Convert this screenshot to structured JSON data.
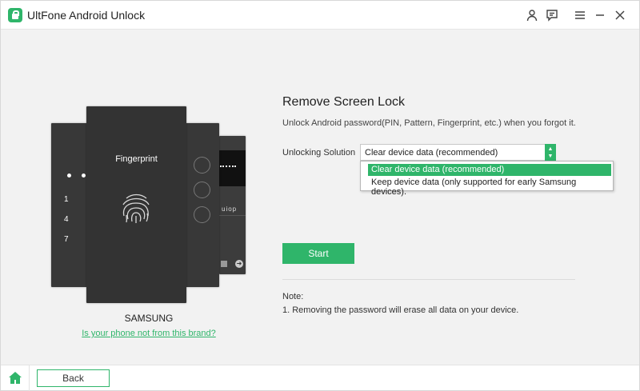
{
  "titlebar": {
    "app_title": "UltFone Android Unlock",
    "icons": [
      "user-icon",
      "feedback-icon",
      "menu-icon",
      "minimize-icon",
      "close-icon"
    ]
  },
  "illustration": {
    "front_label": "Fingerprint",
    "left_digits": [
      "1",
      "4",
      "7"
    ],
    "back_keys": "uiop"
  },
  "brand": {
    "name": "SAMSUNG",
    "link": "Is your phone not from this brand?"
  },
  "panel": {
    "title": "Remove Screen Lock",
    "description": "Unlock Android password(PIN, Pattern, Fingerprint, etc.) when you forgot it.",
    "solution_label": "Unlocking Solution",
    "selected": "Clear device data (recommended)",
    "options": [
      "Clear device data (recommended)",
      "Keep device data (only supported for early Samsung devices)."
    ],
    "start_label": "Start"
  },
  "note": {
    "title": "Note:",
    "text": "1. Removing the password will erase all data on your device."
  },
  "footer": {
    "back_label": "Back"
  },
  "colors": {
    "accent": "#2fb56a",
    "phone": "#333333",
    "background": "#f2f2f2"
  }
}
